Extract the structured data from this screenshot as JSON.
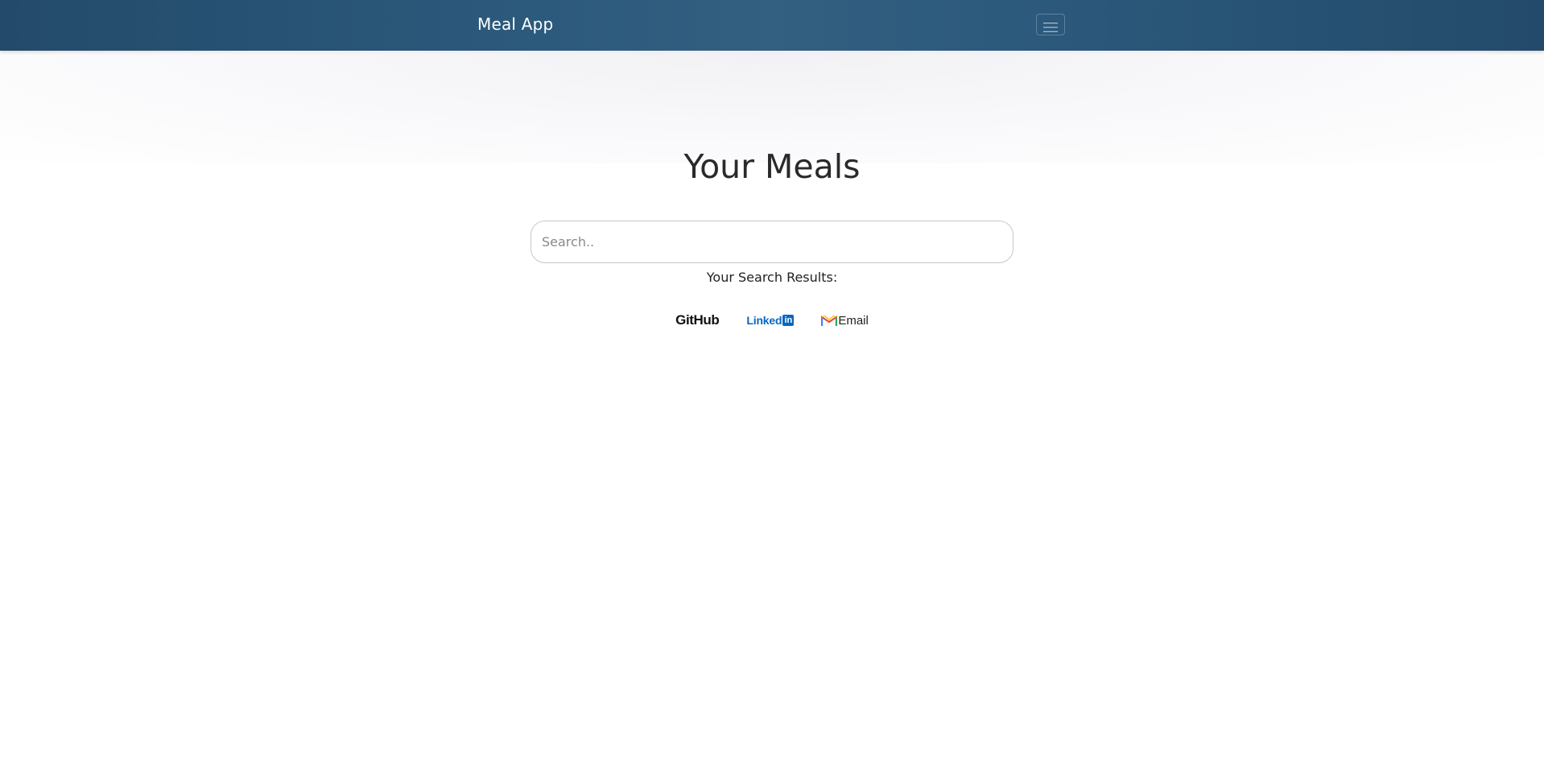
{
  "navbar": {
    "brand": "Meal App",
    "menu_icon": "hamburger-menu-icon"
  },
  "main": {
    "title": "Your Meals",
    "search": {
      "placeholder": "Search..",
      "value": ""
    },
    "results_label": "Your Search Results:"
  },
  "footer_links": {
    "github": {
      "label": "GitHub",
      "icon": "github-logo"
    },
    "linkedin": {
      "label": "Linked",
      "badge": "in",
      "icon": "linkedin-logo"
    },
    "email": {
      "label": "Email",
      "icon": "gmail-icon"
    }
  },
  "colors": {
    "navbar": "#2c5a7d",
    "linkedin_blue": "#0a66c2",
    "text": "#222222"
  }
}
